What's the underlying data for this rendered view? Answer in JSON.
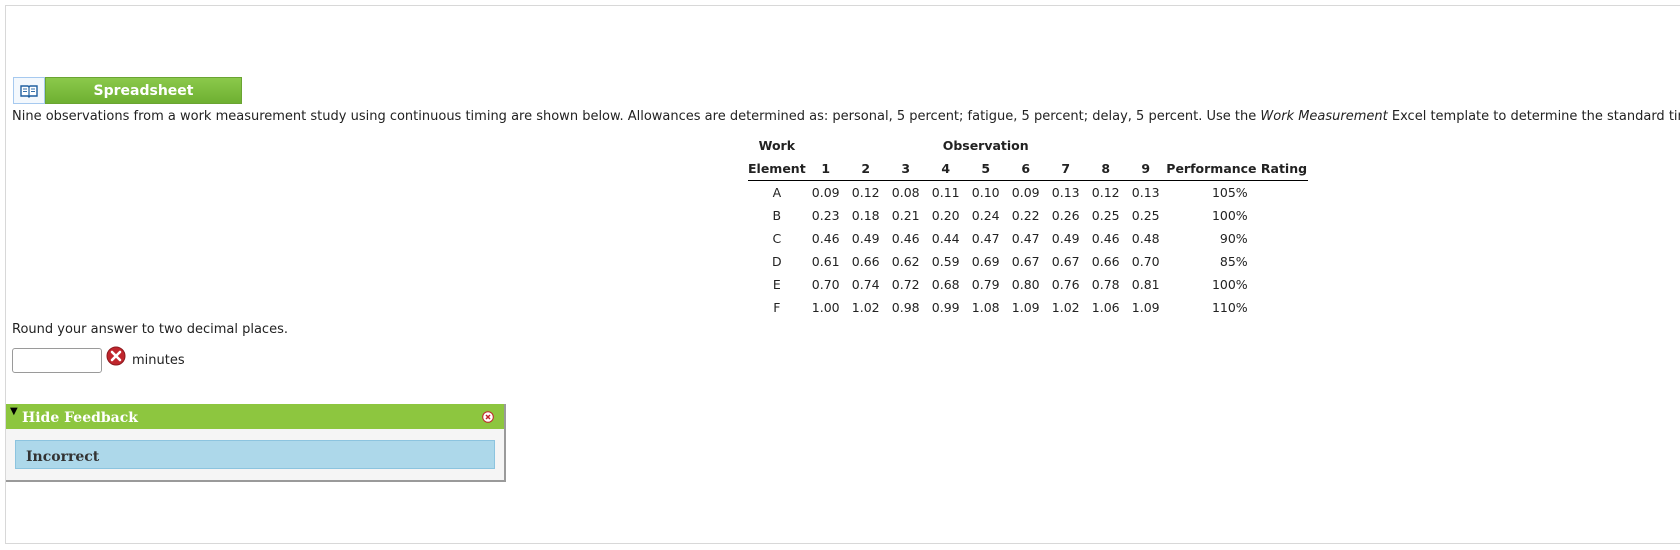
{
  "spreadsheet": {
    "button_label": "Spreadsheet",
    "icon": "book-icon"
  },
  "intro": {
    "text_before": "Nine observations from a work measurement study using continuous timing are shown below. Allowances are determined as: personal, 5 percent; fatigue, 5 percent; delay, 5 percent. Use the ",
    "emphasis": "Work Measurement",
    "text_after": " Excel template to determine the standard time for this operation."
  },
  "table": {
    "header_work": "Work",
    "header_observation": "Observation",
    "header_element": "Element",
    "observation_numbers": [
      "1",
      "2",
      "3",
      "4",
      "5",
      "6",
      "7",
      "8",
      "9"
    ],
    "header_rating": "Performance Rating",
    "rows": [
      {
        "element": "A",
        "values": [
          "0.09",
          "0.12",
          "0.08",
          "0.11",
          "0.10",
          "0.09",
          "0.13",
          "0.12",
          "0.13"
        ],
        "rating": "105%"
      },
      {
        "element": "B",
        "values": [
          "0.23",
          "0.18",
          "0.21",
          "0.20",
          "0.24",
          "0.22",
          "0.26",
          "0.25",
          "0.25"
        ],
        "rating": "100%"
      },
      {
        "element": "C",
        "values": [
          "0.46",
          "0.49",
          "0.46",
          "0.44",
          "0.47",
          "0.47",
          "0.49",
          "0.46",
          "0.48"
        ],
        "rating": "90%"
      },
      {
        "element": "D",
        "values": [
          "0.61",
          "0.66",
          "0.62",
          "0.59",
          "0.69",
          "0.67",
          "0.67",
          "0.66",
          "0.70"
        ],
        "rating": "85%"
      },
      {
        "element": "E",
        "values": [
          "0.70",
          "0.74",
          "0.72",
          "0.68",
          "0.79",
          "0.80",
          "0.76",
          "0.78",
          "0.81"
        ],
        "rating": "100%"
      },
      {
        "element": "F",
        "values": [
          "1.00",
          "1.02",
          "0.98",
          "0.99",
          "1.08",
          "1.09",
          "1.02",
          "1.06",
          "1.09"
        ],
        "rating": "110%"
      }
    ]
  },
  "answer": {
    "instruction": "Round your answer to two decimal places.",
    "value": "",
    "unit": "minutes",
    "status_icon": "error-x-icon"
  },
  "feedback": {
    "toggle_label": "Hide Feedback",
    "result": "Incorrect",
    "colors": {
      "header": "#8dc63f",
      "result_bg": "#add8ea"
    }
  }
}
